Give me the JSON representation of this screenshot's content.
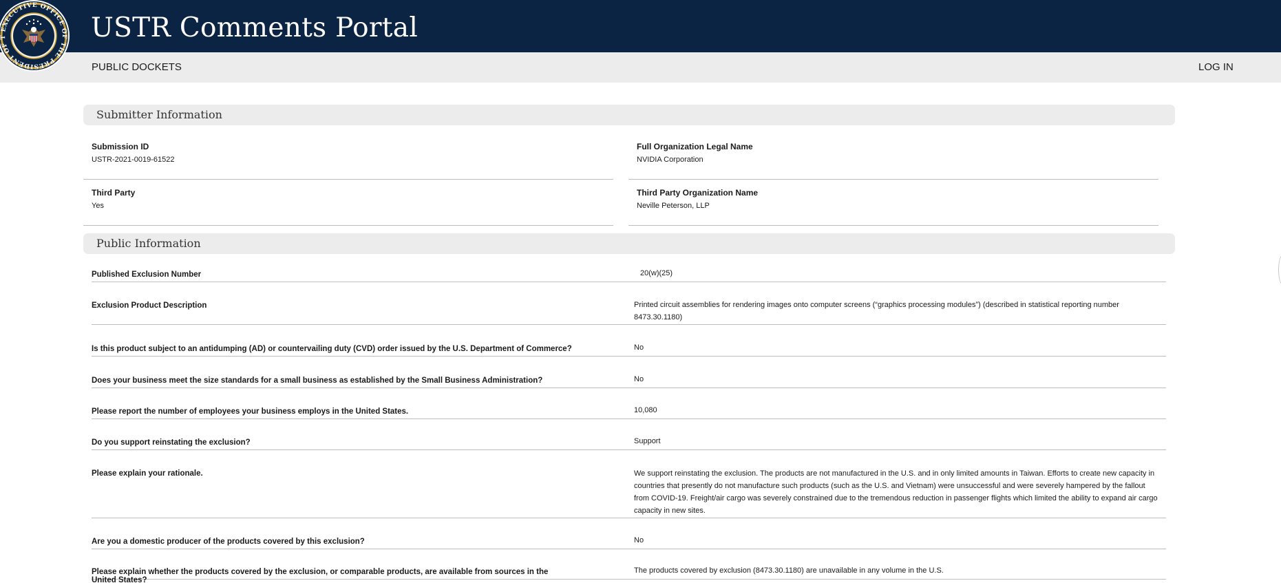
{
  "header": {
    "title": "USTR Comments Portal"
  },
  "seal": {
    "text": "EXECUTIVE OFFICE OF THE PRESIDENT OF THE UNITED STATES"
  },
  "nav": {
    "public_dockets": "PUBLIC DOCKETS",
    "login": "LOG IN"
  },
  "sections": {
    "submitter": "Submitter Information",
    "public": "Public Information"
  },
  "submitter": {
    "submission_id": {
      "label": "Submission ID",
      "value": "USTR-2021-0019-61522"
    },
    "org_name": {
      "label": "Full Organization Legal Name",
      "value": "NVIDIA Corporation"
    },
    "third_party": {
      "label": "Third Party",
      "value": "Yes"
    },
    "third_party_org": {
      "label": "Third Party Organization Name",
      "value": "Neville Peterson, LLP"
    }
  },
  "public_info": [
    {
      "question": "Published Exclusion Number",
      "answer": "20(w)(25)"
    },
    {
      "question": "Exclusion Product Description",
      "answer": "Printed circuit assemblies for rendering images onto computer screens (“graphics processing modules”) (described in statistical reporting number 8473.30.1180)"
    },
    {
      "question": "Is this product subject to an antidumping (AD) or countervailing duty (CVD) order issued by the U.S. Department of Commerce?",
      "answer": "No"
    },
    {
      "question": "Does your business meet the size standards for a small business as established by the Small Business Administration?",
      "answer": "No"
    },
    {
      "question": "Please report the number of employees your business employs in the United States.",
      "answer": "10,080"
    },
    {
      "question": "Do you support reinstating the exclusion?",
      "answer": "Support"
    },
    {
      "question": "Please explain your rationale.",
      "answer": "We support reinstating the exclusion. The products are not manufactured in the U.S. and in only limited amounts in Taiwan. Efforts to create new capacity in countries that presently do not manufacture such products (such as the U.S. and Vietnam) were unsuccessful and were severely hampered by the fallout from COVID-19. Freight/air cargo was severely constrained due to the tremendous reduction in passenger flights which limited the ability to expand air cargo capacity in new sites."
    },
    {
      "question": "Are you a domestic producer of the products covered by this exclusion?",
      "answer": "No"
    },
    {
      "question": "Please explain whether the products covered by the exclusion, or comparable products, are available from sources in the United States?",
      "answer": "The products covered by exclusion (8473.30.1180) are unavailable in any volume in the U.S."
    }
  ]
}
